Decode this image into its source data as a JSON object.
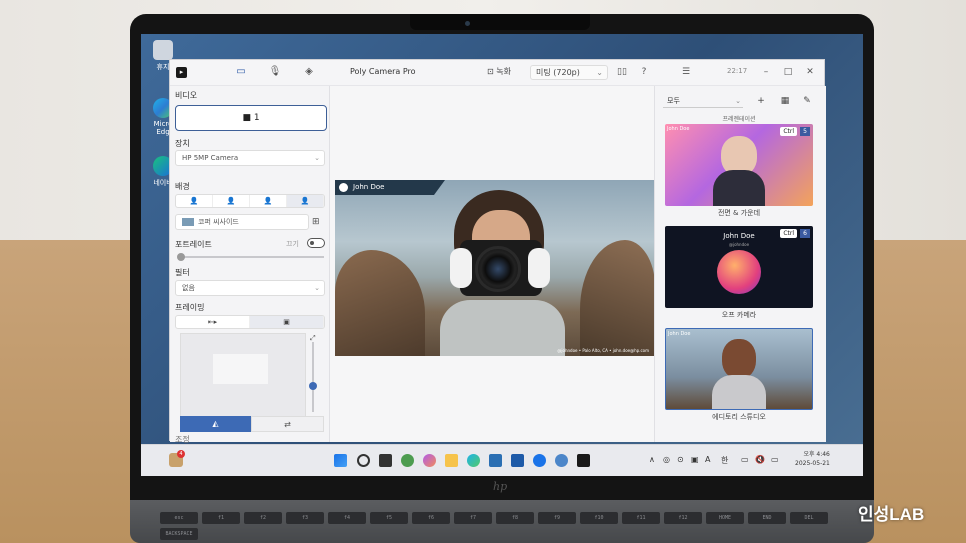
{
  "desktop": {
    "icons": [
      "휴지",
      "Micro Edg",
      "네이버"
    ]
  },
  "app": {
    "title": "Poly Camera Pro",
    "record_label": "녹화",
    "preset": "미팅 (720p)",
    "time_display": "22:17"
  },
  "left_panel": {
    "video_label": "비디오",
    "video_value": "1",
    "device_label": "장치",
    "device_value": "HP 5MP Camera",
    "background_label": "배경",
    "background_value": "코퍼 씨사이드",
    "portrait_label": "포트레이트",
    "portrait_state": "끄기",
    "filter_label": "필터",
    "filter_value": "없음",
    "framing_label": "프레이밍",
    "bottom_label": "조정"
  },
  "preview": {
    "name_tag": "John Doe",
    "caption": "@johndoe • Palo Alto, CA • john.doe@hp.com"
  },
  "right_panel": {
    "filter": "모두",
    "top_label": "프레젠테이션",
    "scenes": [
      {
        "name": "전면 & 가운데",
        "shortcut": "Ctrl",
        "number": "5",
        "tag": "John Doe"
      },
      {
        "name": "오프 카메라",
        "shortcut": "Ctrl",
        "number": "6",
        "tag": "John Doe",
        "handle": "@johndoe"
      },
      {
        "name": "에디토리 스튜디오",
        "shortcut": "",
        "number": "",
        "tag": "John Doe"
      }
    ]
  },
  "taskbar": {
    "notification_count": "4",
    "tray_items": [
      "∧",
      "한"
    ],
    "clock_time": "오후 4:46",
    "clock_date": "2025-05-21"
  },
  "watermark": "인성LAB",
  "keyboard_keys": [
    "esc",
    "f1",
    "f2",
    "f3",
    "f4",
    "f5",
    "f6",
    "f7",
    "f8",
    "f9",
    "f10",
    "f11",
    "f12",
    "HOME",
    "END",
    "DEL",
    "BACKSPACE"
  ]
}
